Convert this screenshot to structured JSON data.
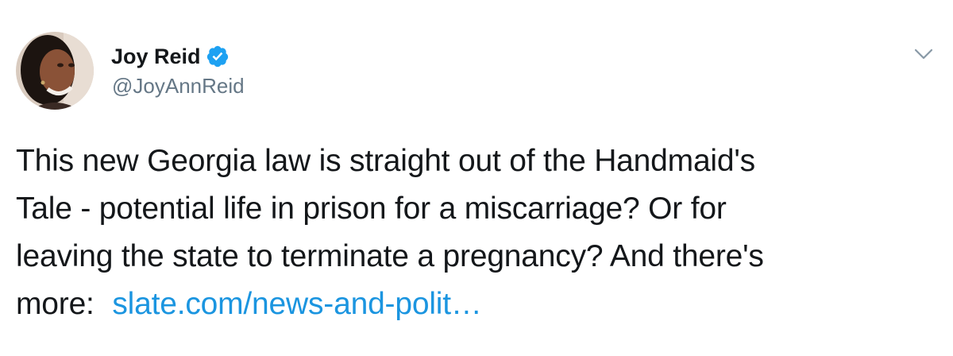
{
  "author": {
    "display_name": "Joy Reid",
    "handle": "@JoyAnnReid",
    "verified": true,
    "avatar_icon": "profile-photo-icon",
    "verified_icon": "verified-badge-icon"
  },
  "menu": {
    "icon": "chevron-down-icon"
  },
  "tweet": {
    "lines": [
      "This new Georgia law is straight out of the Handmaid's",
      "Tale - potential life in prison for a miscarriage? Or for",
      "leaving the state to terminate a pregnancy? And there's",
      "more: "
    ],
    "link_text": "slate.com/news-and-polit…"
  },
  "colors": {
    "text": "#14171a",
    "secondary": "#657786",
    "link": "#1b95e0",
    "verified": "#1da1f2"
  }
}
